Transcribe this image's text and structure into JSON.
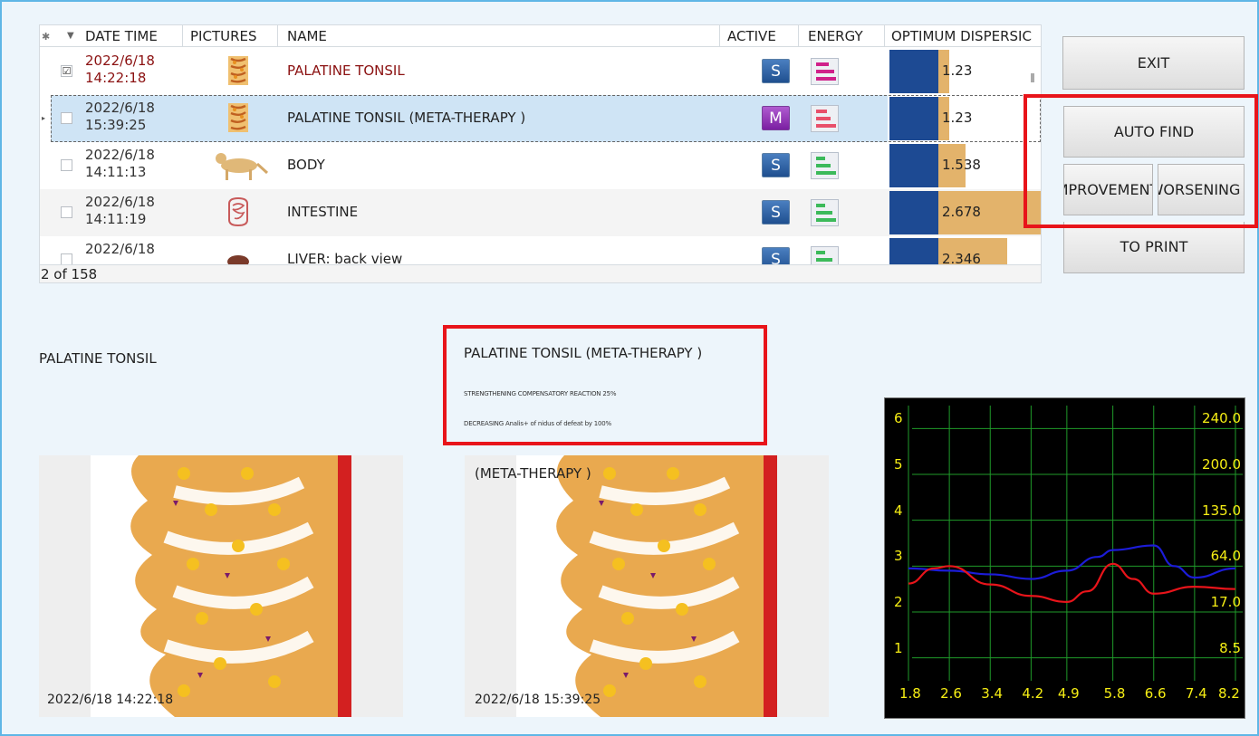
{
  "grid": {
    "headers": [
      "DATE TIME",
      "PICTURES",
      "NAME",
      "ACTIVE",
      "ENERGY",
      "OPTIMUM DISPERSIC"
    ],
    "rows": [
      {
        "date": "2022/6/18",
        "time": "14:22:18",
        "name": "PALATINE TONSIL",
        "active": "S",
        "dispersion": "1.23",
        "checked": "☑"
      },
      {
        "date": "2022/6/18",
        "time": "15:39:25",
        "name": "PALATINE TONSIL (META-THERAPY )",
        "active": "M",
        "dispersion": "1.23",
        "checked": ""
      },
      {
        "date": "2022/6/18",
        "time": "14:11:13",
        "name": "BODY",
        "active": "S",
        "dispersion": "1.538",
        "checked": ""
      },
      {
        "date": "2022/6/18",
        "time": "14:11:19",
        "name": "INTESTINE",
        "active": "S",
        "dispersion": "2.678",
        "checked": ""
      },
      {
        "date": "2022/6/18",
        "time": "",
        "name": "LIVER: back view",
        "active": "S",
        "dispersion": "2.346",
        "checked": ""
      }
    ],
    "footer": "2 of 158"
  },
  "buttons": {
    "exit": "EXIT",
    "auto_find": "AUTO FIND",
    "improvement": "IMPROVEMENT",
    "worsening": "WORSENING",
    "to_print": "TO PRINT"
  },
  "left_panel": {
    "title": "PALATINE TONSIL",
    "timestamp": "2022/6/18 14:22:18"
  },
  "middle_panel": {
    "title": "PALATINE TONSIL (META-THERAPY )",
    "line1": "STRENGTHENING COMPENSATORY REACTION 25%",
    "line2": "DECREASING Analis+ of nidus of defeat by 100%",
    "image_caption": "(META-THERAPY )",
    "timestamp": "2022/6/18 15:39:25"
  },
  "chart_data": {
    "type": "line",
    "y_left_ticks": [
      "6",
      "5",
      "4",
      "3",
      "2",
      "1"
    ],
    "y_right_ticks": [
      "240.0",
      "200.0",
      "135.0",
      "64.0",
      "17.0",
      "8.5"
    ],
    "x_ticks": [
      "1.8",
      "2.6",
      "3.4",
      "4.2",
      "4.9",
      "5.8",
      "6.6",
      "7.4",
      "8.2"
    ],
    "ylim": [
      0.5,
      6.5
    ],
    "grid": true,
    "colors": {
      "background": "#000000",
      "grid": "#1f9a2a",
      "labels": "#f6ee14",
      "red": "#e8141a",
      "blue": "#1c1cd8"
    },
    "series": [
      {
        "color": "#1c1cd8",
        "x": [
          1.8,
          2.6,
          3.4,
          4.2,
          4.9,
          5.5,
          5.8,
          6.6,
          7.0,
          7.4,
          8.2
        ],
        "y": [
          2.95,
          2.9,
          2.82,
          2.72,
          2.9,
          3.2,
          3.35,
          3.45,
          3.0,
          2.75,
          2.95
        ]
      },
      {
        "color": "#e8141a",
        "x": [
          1.8,
          2.3,
          2.6,
          3.4,
          4.2,
          4.9,
          5.3,
          5.8,
          6.2,
          6.6,
          7.4,
          8.2
        ],
        "y": [
          2.62,
          2.95,
          3.0,
          2.6,
          2.35,
          2.22,
          2.45,
          3.05,
          2.72,
          2.4,
          2.55,
          2.5
        ]
      }
    ]
  }
}
